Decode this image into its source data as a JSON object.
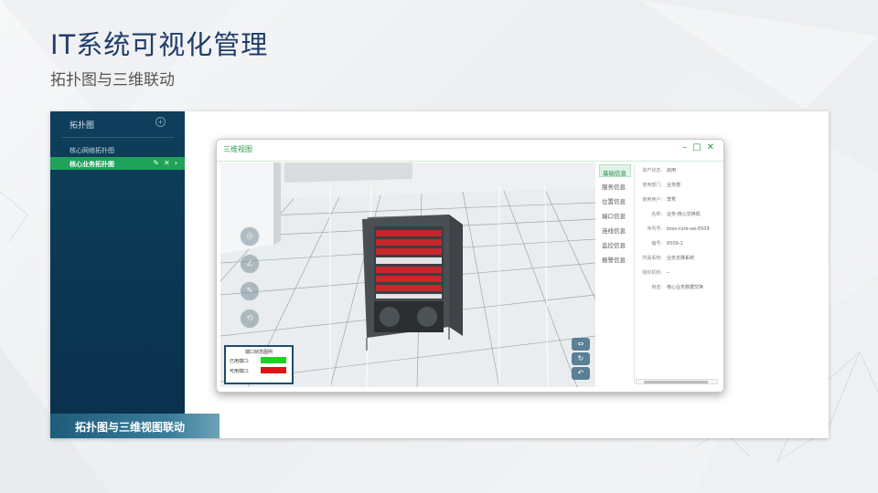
{
  "slide": {
    "title": "IT系统可视化管理",
    "subtitle": "拓扑图与三维联动"
  },
  "left_panel": {
    "header": "拓扑图",
    "add_icon": "plus-circle-icon",
    "items": [
      {
        "label": "核心网络拓扑图",
        "active": false
      },
      {
        "label": "核心业务拓扑图",
        "active": true
      }
    ],
    "item_action_icons": [
      "edit-icon",
      "close-icon",
      "chevron-right-icon"
    ]
  },
  "caption": "拓扑图与三维视图联动",
  "window": {
    "title": "三维视图",
    "controls": [
      "minimize-icon",
      "maximize-icon",
      "close-icon"
    ],
    "tools": [
      "compass-icon",
      "angle-icon",
      "ruler-icon",
      "orbit-icon"
    ],
    "right_tools": [
      "expand-icon",
      "rotate-icon",
      "back-icon"
    ],
    "legend": {
      "title": "端口状态图例",
      "rows": [
        {
          "label": "已用端口:",
          "color": "#1fd21f"
        },
        {
          "label": "可用端口:",
          "color": "#e01414"
        }
      ]
    },
    "tabs": [
      "基础信息",
      "服务信息",
      "位置信息",
      "端口信息",
      "连线信息",
      "监控信息",
      "报警信息"
    ],
    "active_tab": "基础信息",
    "info": [
      {
        "label": "资产状态:",
        "value": "启用"
      },
      {
        "label": "使用部门:",
        "value": "业务部"
      },
      {
        "label": "使用用户:",
        "value": "李秀"
      },
      {
        "label": "名称:",
        "value": "业务-核心交换机"
      },
      {
        "label": "序列号:",
        "value": "bsss-core-sw-6509"
      },
      {
        "label": "编号:",
        "value": "6509-1"
      },
      {
        "label": "所属系统:",
        "value": "业务支撑系统"
      },
      {
        "label": "组织机构:",
        "value": "--"
      },
      {
        "label": "用途:",
        "value": "核心业务数据交换"
      }
    ]
  },
  "colors": {
    "accent_green": "#1fa25a",
    "panel_navy": "#0b3552",
    "title_blue": "#1e3d6b"
  }
}
